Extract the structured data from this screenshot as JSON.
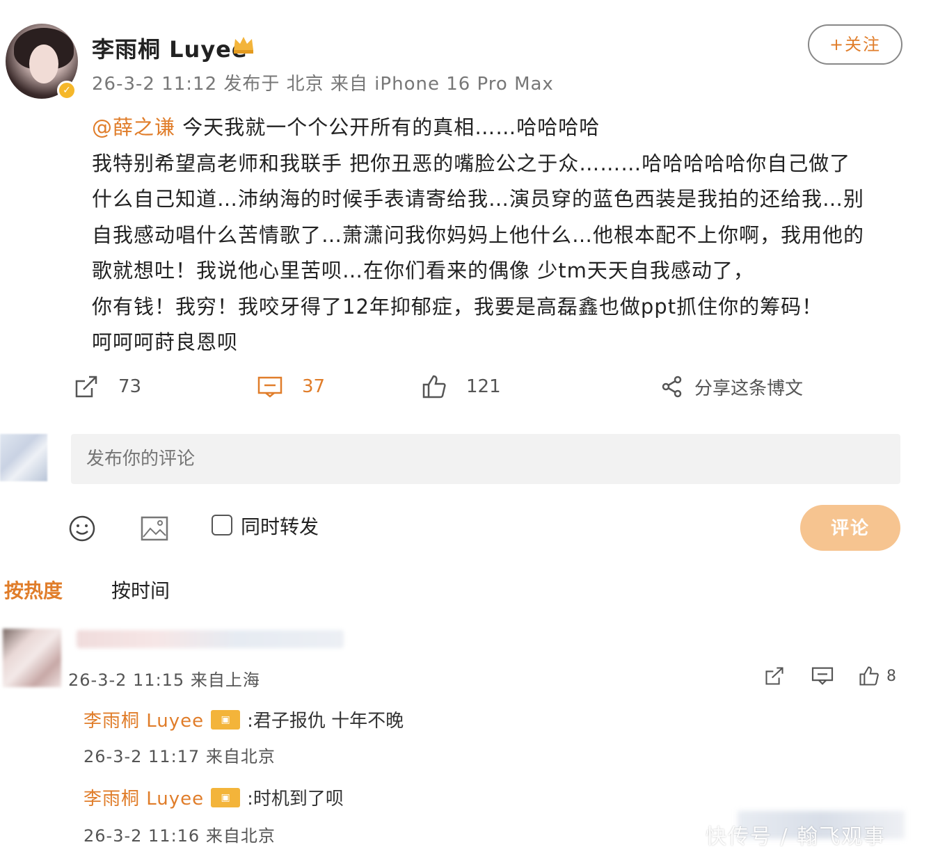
{
  "post": {
    "author": "李雨桐 Luyee",
    "meta": "26-3-2 11:12 发布于 北京 来自 iPhone 16 Pro Max",
    "follow_label": "+关注",
    "mention": "@薛之谦",
    "line1_rest": " 今天我就一个个公开所有的真相……哈哈哈哈",
    "lines": [
      "我特别希望高老师和我联手 把你丑恶的嘴脸公之于众………哈哈哈哈哈你自己做了",
      "什么自己知道…沛纳海的时候手表请寄给我…演员穿的蓝色西装是我拍的还给我…别",
      "自我感动唱什么苦情歌了…萧潇问我你妈妈上他什么…他根本配不上你啊，我用他的",
      "歌就想吐！我说他心里苦呗…在你们看来的偶像 少tm天天自我感动了，",
      "你有钱！我穷！我咬牙得了12年抑郁症，我要是高磊鑫也做ppt抓住你的筹码！",
      "呵呵呵莳良恩呗"
    ],
    "repost_count": "73",
    "comment_count": "37",
    "like_count": "121",
    "share_label": "分享这条博文"
  },
  "composer": {
    "placeholder": "发布你的评论",
    "repost_label": "同时转发",
    "submit_label": "评论"
  },
  "sort_tabs": {
    "hot": "按热度",
    "time": "按时间"
  },
  "comment": {
    "meta": "26-3-2 11:15 来自上海",
    "like_count": "8",
    "replies": [
      {
        "name": "李雨桐 Luyee",
        "text": ":君子报仇 十年不晚",
        "meta": "26-3-2 11:17 来自北京"
      },
      {
        "name": "李雨桐 Luyee",
        "text": ":时机到了呗",
        "meta": "26-3-2 11:16 来自北京"
      }
    ]
  },
  "watermark": "快传号 / 翰飞观事",
  "colors": {
    "accent": "#e07d2a",
    "submit_bg": "#f6c490",
    "input_bg": "#f2f2f2",
    "badge": "#f3b43a"
  }
}
